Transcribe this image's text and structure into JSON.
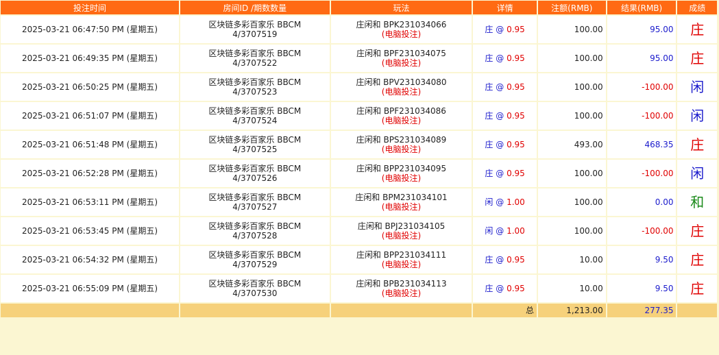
{
  "headers": {
    "time": "投注时间",
    "room": "房间ID /期数数量",
    "play": "玩法",
    "detail": "详情",
    "amount": "注额(RMB)",
    "result": "结果(RMB)",
    "outcome": "成绩"
  },
  "rows": [
    {
      "time": "2025-03-21 06:47:50 PM (星期五)",
      "room": "区块链多彩百家乐 BBCM",
      "round": "4/3707519",
      "play": "庄闲和 BPK231034066",
      "source": "(电脑投注)",
      "side": "庄",
      "at": "@",
      "odds": "0.95",
      "amount": "100.00",
      "result": "95.00",
      "result_sign": "pos",
      "outcome": "庄",
      "outcome_type": "banker"
    },
    {
      "time": "2025-03-21 06:49:35 PM (星期五)",
      "room": "区块链多彩百家乐 BBCM",
      "round": "4/3707522",
      "play": "庄闲和 BPF231034075",
      "source": "(电脑投注)",
      "side": "庄",
      "at": "@",
      "odds": "0.95",
      "amount": "100.00",
      "result": "95.00",
      "result_sign": "pos",
      "outcome": "庄",
      "outcome_type": "banker"
    },
    {
      "time": "2025-03-21 06:50:25 PM (星期五)",
      "room": "区块链多彩百家乐 BBCM",
      "round": "4/3707523",
      "play": "庄闲和 BPV231034080",
      "source": "(电脑投注)",
      "side": "庄",
      "at": "@",
      "odds": "0.95",
      "amount": "100.00",
      "result": "-100.00",
      "result_sign": "neg",
      "outcome": "闲",
      "outcome_type": "player"
    },
    {
      "time": "2025-03-21 06:51:07 PM (星期五)",
      "room": "区块链多彩百家乐 BBCM",
      "round": "4/3707524",
      "play": "庄闲和 BPF231034086",
      "source": "(电脑投注)",
      "side": "庄",
      "at": "@",
      "odds": "0.95",
      "amount": "100.00",
      "result": "-100.00",
      "result_sign": "neg",
      "outcome": "闲",
      "outcome_type": "player"
    },
    {
      "time": "2025-03-21 06:51:48 PM (星期五)",
      "room": "区块链多彩百家乐 BBCM",
      "round": "4/3707525",
      "play": "庄闲和 BPS231034089",
      "source": "(电脑投注)",
      "side": "庄",
      "at": "@",
      "odds": "0.95",
      "amount": "493.00",
      "result": "468.35",
      "result_sign": "pos",
      "outcome": "庄",
      "outcome_type": "banker"
    },
    {
      "time": "2025-03-21 06:52:28 PM (星期五)",
      "room": "区块链多彩百家乐 BBCM",
      "round": "4/3707526",
      "play": "庄闲和 BPP231034095",
      "source": "(电脑投注)",
      "side": "庄",
      "at": "@",
      "odds": "0.95",
      "amount": "100.00",
      "result": "-100.00",
      "result_sign": "neg",
      "outcome": "闲",
      "outcome_type": "player"
    },
    {
      "time": "2025-03-21 06:53:11 PM (星期五)",
      "room": "区块链多彩百家乐 BBCM",
      "round": "4/3707527",
      "play": "庄闲和 BPM231034101",
      "source": "(电脑投注)",
      "side": "闲",
      "at": "@",
      "odds": "1.00",
      "amount": "100.00",
      "result": "0.00",
      "result_sign": "pos",
      "outcome": "和",
      "outcome_type": "tie"
    },
    {
      "time": "2025-03-21 06:53:45 PM (星期五)",
      "room": "区块链多彩百家乐 BBCM",
      "round": "4/3707528",
      "play": "庄闲和 BPJ231034105",
      "source": "(电脑投注)",
      "side": "闲",
      "at": "@",
      "odds": "1.00",
      "amount": "100.00",
      "result": "-100.00",
      "result_sign": "neg",
      "outcome": "庄",
      "outcome_type": "banker"
    },
    {
      "time": "2025-03-21 06:54:32 PM (星期五)",
      "room": "区块链多彩百家乐 BBCM",
      "round": "4/3707529",
      "play": "庄闲和 BPP231034111",
      "source": "(电脑投注)",
      "side": "庄",
      "at": "@",
      "odds": "0.95",
      "amount": "10.00",
      "result": "9.50",
      "result_sign": "pos",
      "outcome": "庄",
      "outcome_type": "banker"
    },
    {
      "time": "2025-03-21 06:55:09 PM (星期五)",
      "room": "区块链多彩百家乐 BBCM",
      "round": "4/3707530",
      "play": "庄闲和 BPB231034113",
      "source": "(电脑投注)",
      "side": "庄",
      "at": "@",
      "odds": "0.95",
      "amount": "10.00",
      "result": "9.50",
      "result_sign": "pos",
      "outcome": "庄",
      "outcome_type": "banker"
    }
  ],
  "totals": {
    "label": "总",
    "amount": "1,213.00",
    "result": "277.35"
  },
  "colors": {
    "header_bg": "#ff6a13",
    "page_bg": "#fbf6d2",
    "total_bg": "#f6d17b",
    "positive": "#1a1acc",
    "negative": "#e00000",
    "banker": "#e00000",
    "player": "#1a1acc",
    "tie": "#1a8a1a"
  }
}
